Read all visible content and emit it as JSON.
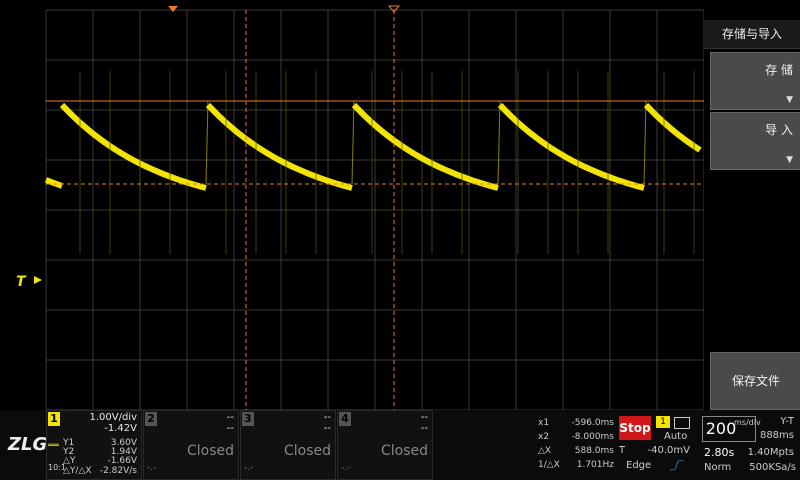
{
  "right_panel": {
    "title": "存储与导入",
    "save_label": "存 储",
    "import_label": "导 入",
    "save_file_label": "保存文件"
  },
  "colors": {
    "trace": "#f2e400",
    "cursor": "#e87a2a",
    "grid": "#3a3a3a",
    "stop": "#d01818"
  },
  "trigger_marker": "T",
  "logo": "ZLG",
  "channels": [
    {
      "num": "1",
      "scale": "1.00V/div",
      "offset": "-1.42V",
      "y1_label": "Y1",
      "y1": "3.60V",
      "y2_label": "Y2",
      "y2": "1.94V",
      "dy_label": "△Y",
      "dy": "-1.66V",
      "dydx_label": "△Y/△X",
      "dydx": "-2.82V/s",
      "bw": "10:1"
    },
    {
      "num": "2",
      "v1": "--",
      "v2": "--",
      "status": "Closed",
      "dash": "-.-"
    },
    {
      "num": "3",
      "v1": "--",
      "v2": "--",
      "status": "Closed",
      "dash": "-.-"
    },
    {
      "num": "4",
      "v1": "--",
      "v2": "--",
      "status": "Closed",
      "dash": "-.-"
    }
  ],
  "cursors": {
    "x1_label": "x1",
    "x1": "-596.0ms",
    "x2_label": "x2",
    "x2": "-8.000ms",
    "dx_label": "△X",
    "dx": "588.0ms",
    "inv_label": "1/△X",
    "inv": "1.701Hz"
  },
  "run": {
    "state": "Stop",
    "trig_channel": "1",
    "trig_mode": "Auto",
    "level_label": "T",
    "level": "-40.0mV",
    "type": "Edge"
  },
  "timebase": {
    "value": "200",
    "unit": "ms/div",
    "mode": "Y-T",
    "position": "888ms",
    "delay": "2.80s",
    "points": "1.40Mpts",
    "acq": "Norm",
    "rate": "500KSa/s"
  },
  "waveform": {
    "v_per_div": 1.0,
    "offset_v": -1.42,
    "cursor_y1_v": 3.6,
    "cursor_y2_v": 1.94,
    "trigger_level_v": -0.04,
    "period_ms": 588,
    "high_v": 3.6,
    "low_v": 1.94
  }
}
